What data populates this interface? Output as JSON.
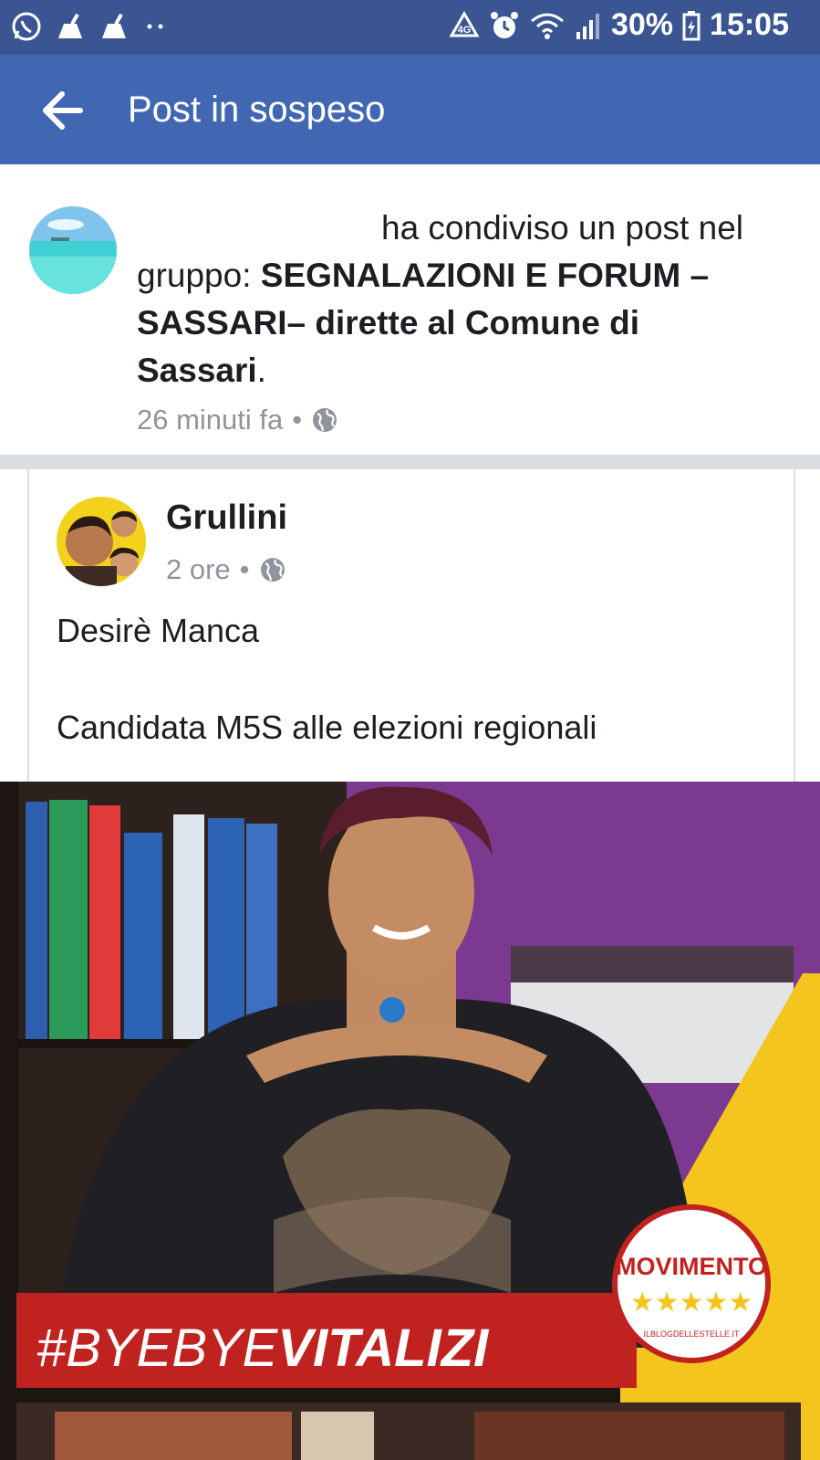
{
  "status": {
    "battery": "30%",
    "time": "15:05"
  },
  "header": {
    "title": "Post in sospeso"
  },
  "notification": {
    "text_part1": "ha condiviso un post nel gruppo: ",
    "group_name": "SEGNALAZIONI E FORUM – SASSARI– dirette al Comune di Sassari",
    "text_end": ".",
    "time": "26 minuti fa",
    "separator": "•"
  },
  "post": {
    "author": "Grullini",
    "time": "2 ore",
    "separator": "•",
    "line1": "Desirè Manca",
    "line2": "Candidata M5S alle elezioni regionali"
  },
  "image": {
    "hashtag_prefix": "#BYEBYE",
    "hashtag_bold": "VITALIZI",
    "logo_text": "MOVIMENTO",
    "logo_sub": "ILBLOGDELLESTELLE.IT",
    "stars": "★★★★★"
  },
  "colors": {
    "status_bar": "#3a5592",
    "app_bar": "#4267b2",
    "banner_red": "#c0221f",
    "accent_yellow": "#f4c51c",
    "wall_purple": "#7b3a8f"
  }
}
